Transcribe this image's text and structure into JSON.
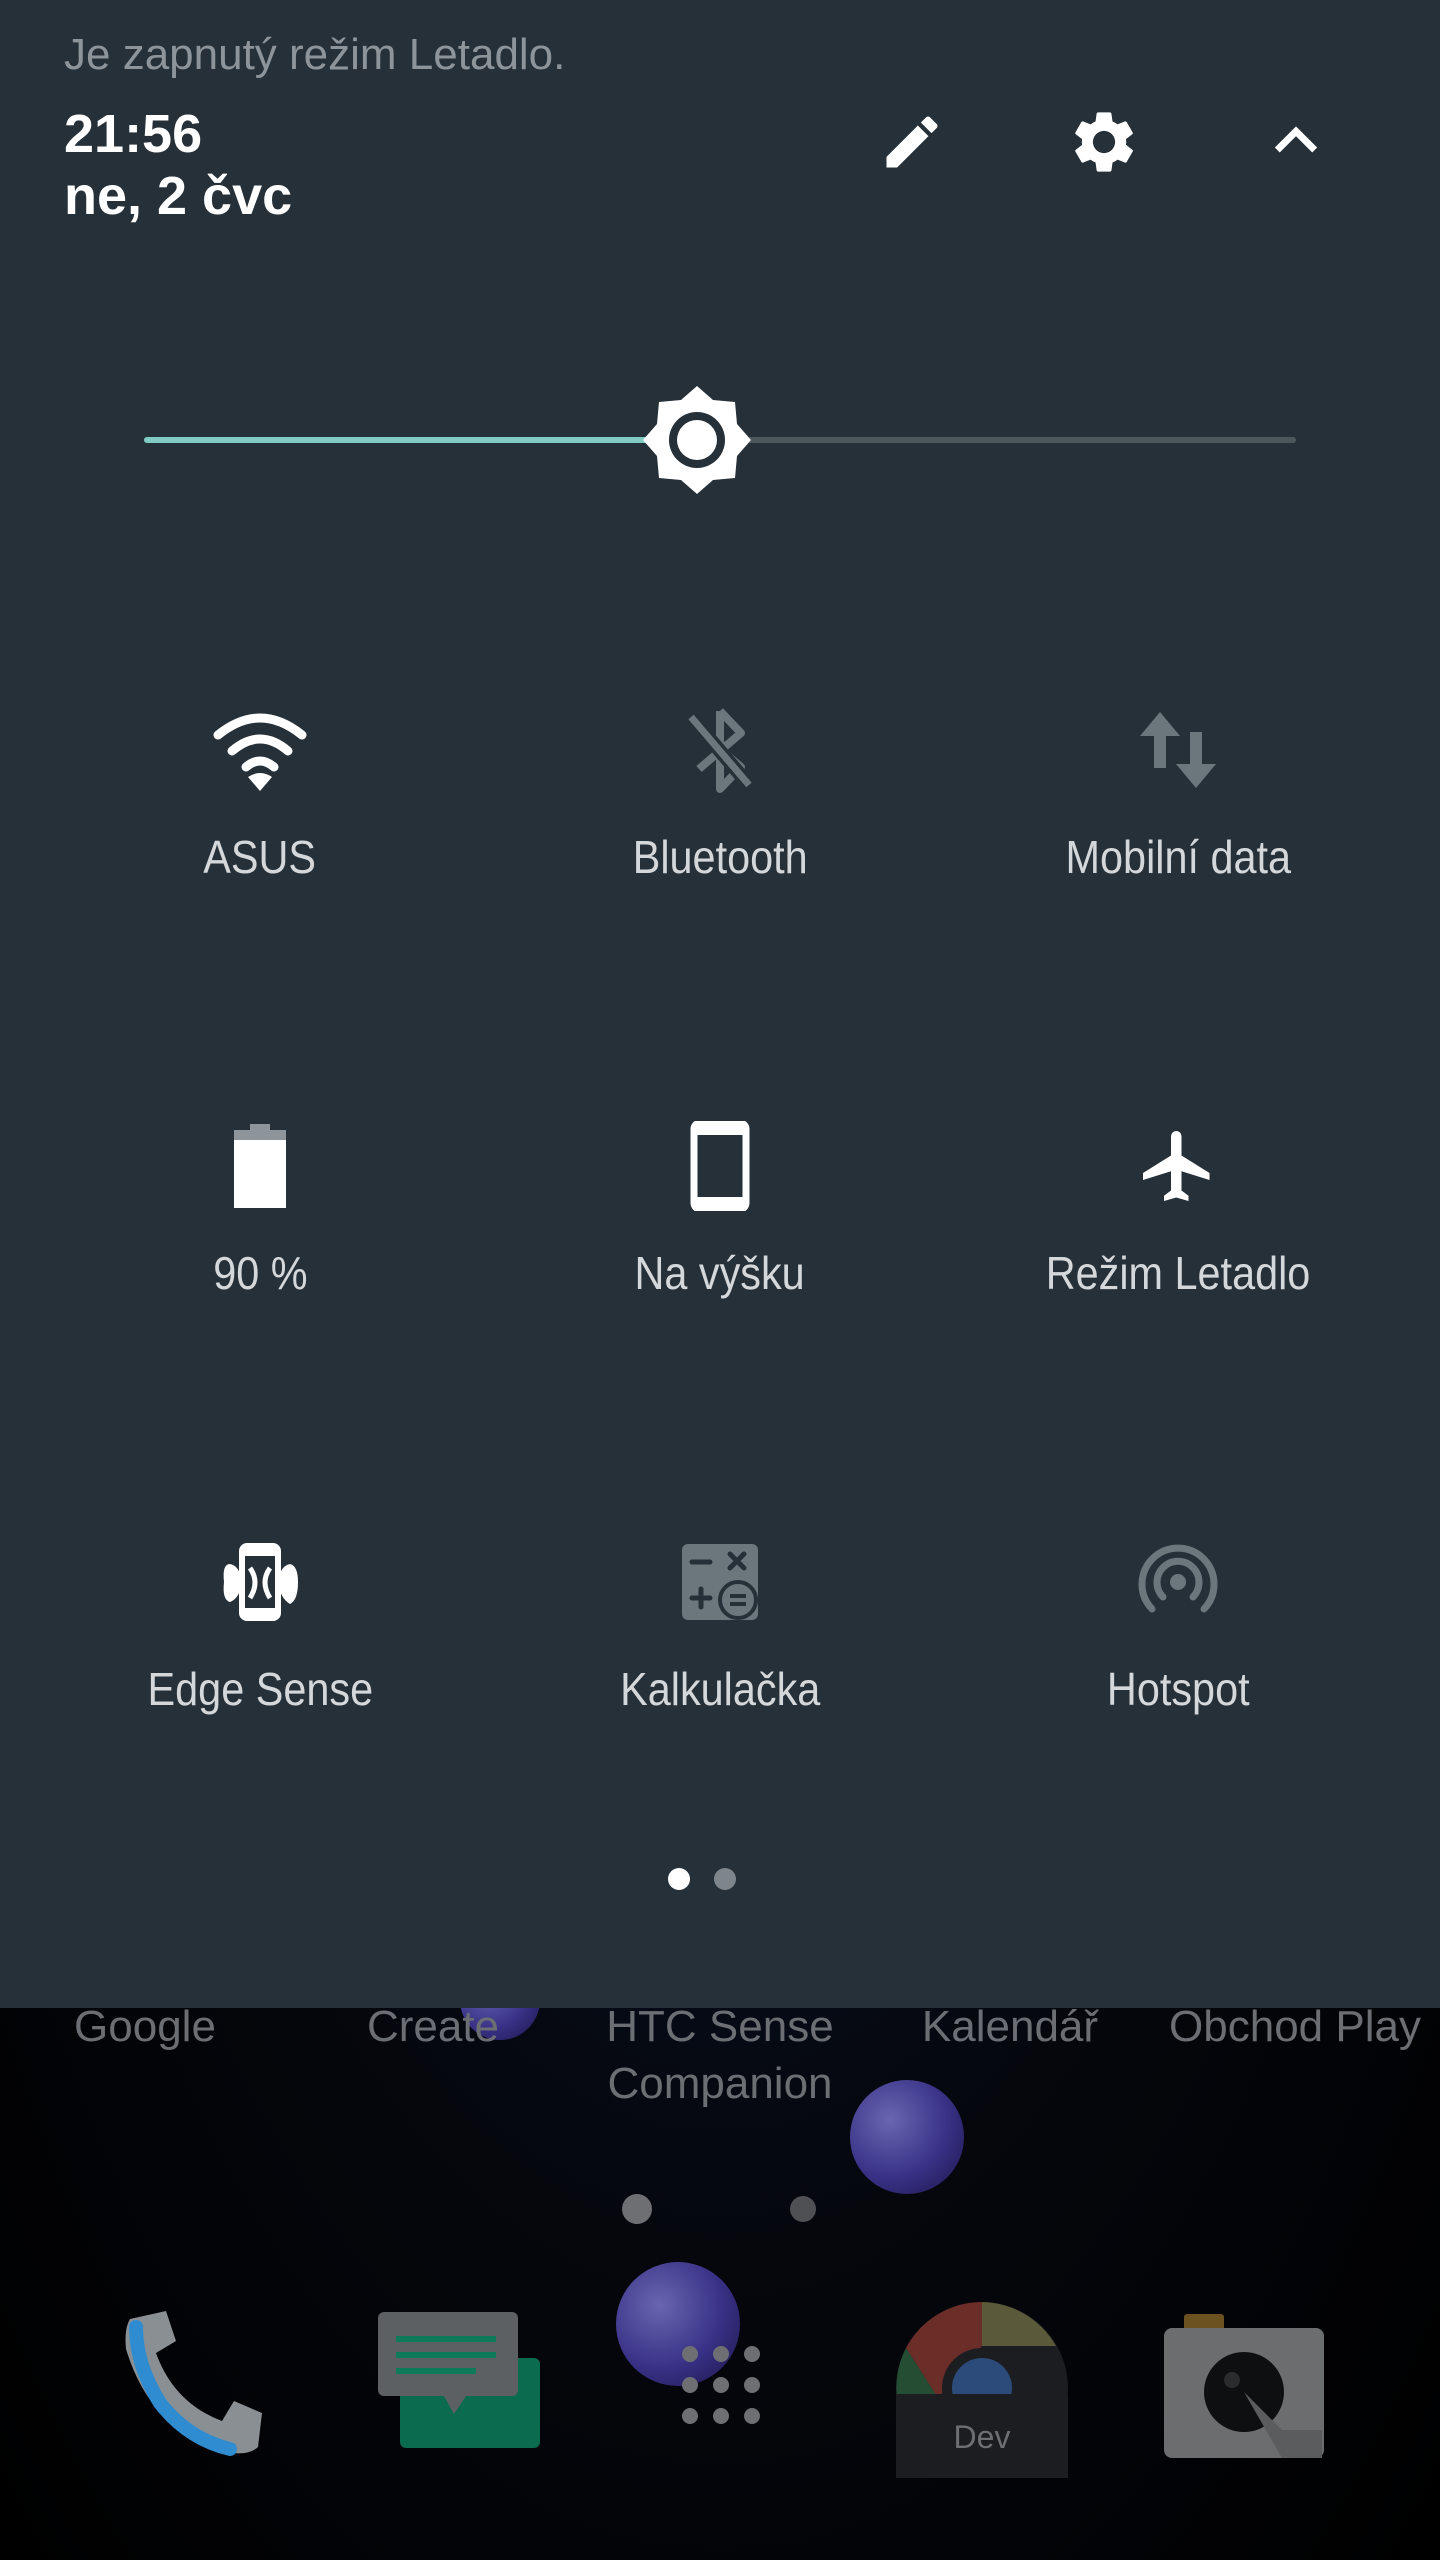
{
  "home": {
    "apps": [
      {
        "label": "Google"
      },
      {
        "label": "Create"
      },
      {
        "label": "HTC Sense\nCompanion"
      },
      {
        "label": "Kalendář"
      },
      {
        "label": "Obchod Play"
      }
    ],
    "dock": [
      {
        "name": "phone",
        "icon": "phone-icon"
      },
      {
        "name": "messages",
        "icon": "messages-icon"
      },
      {
        "name": "app-drawer",
        "icon": "app-drawer-icon"
      },
      {
        "name": "chrome-dev",
        "icon": "chrome-dev-icon",
        "badge": "Dev"
      },
      {
        "name": "camera",
        "icon": "camera-icon"
      }
    ]
  },
  "shade": {
    "status_text": "Je zapnutý režim Letadlo.",
    "time": "21:56",
    "date": "ne, 2 čvc",
    "header_icons": [
      "edit-icon",
      "settings-icon",
      "collapse-icon"
    ],
    "brightness": {
      "level": 0.48,
      "accent": "#80cbc4"
    },
    "tiles": [
      {
        "label": "ASUS",
        "icon": "wifi-icon",
        "active": true
      },
      {
        "label": "Bluetooth",
        "icon": "bluetooth-off-icon",
        "active": false
      },
      {
        "label": "Mobilní data",
        "icon": "mobile-data-icon",
        "active": false
      },
      {
        "label": "90 %",
        "icon": "battery-icon",
        "active": true
      },
      {
        "label": "Na výšku",
        "icon": "portrait-icon",
        "active": true
      },
      {
        "label": "Režim Letadlo",
        "icon": "airplane-icon",
        "active": true
      },
      {
        "label": "Edge Sense",
        "icon": "edge-sense-icon",
        "active": true
      },
      {
        "label": "Kalkulačka",
        "icon": "calculator-icon",
        "active": false
      },
      {
        "label": "Hotspot",
        "icon": "hotspot-icon",
        "active": false
      }
    ],
    "pages": {
      "count": 2,
      "current": 1
    },
    "colors": {
      "background": "#263038",
      "active_icon": "#ffffff",
      "inactive_icon": "#6c767d"
    }
  }
}
